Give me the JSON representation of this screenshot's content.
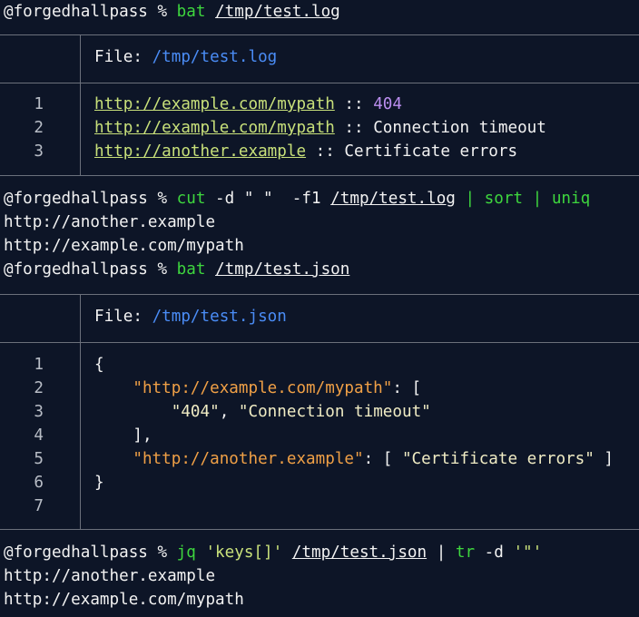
{
  "session": {
    "prompt_user": "@forgedhallpass",
    "prompt_symbol": "%",
    "commands": [
      {
        "cmd": "bat",
        "arg": "/tmp/test.log"
      },
      {
        "cmd": "cut",
        "args": "-d \" \"  -f1",
        "path": "/tmp/test.log",
        "pipe1": "|",
        "cmd2": "sort",
        "pipe2": "|",
        "cmd3": "uniq"
      },
      {
        "cmd": "bat",
        "arg": "/tmp/test.json"
      },
      {
        "cmd": "jq",
        "filter": "'keys[]'",
        "path": "/tmp/test.json",
        "pipe": "|",
        "cmd2": "tr",
        "args2": "-d",
        "quote": "'\"'"
      }
    ]
  },
  "bat_log": {
    "file_label": "File:",
    "file_path": "/tmp/test.log",
    "lines": [
      {
        "num": "1",
        "url": "http://example.com/mypath",
        "sep": " :: ",
        "msg": "404"
      },
      {
        "num": "2",
        "url": "http://example.com/mypath",
        "sep": " :: ",
        "msg": "Connection timeout"
      },
      {
        "num": "3",
        "url": "http://another.example",
        "sep": " :: ",
        "msg": "Certificate errors"
      }
    ]
  },
  "cut_output": [
    "http://another.example",
    "http://example.com/mypath"
  ],
  "bat_json": {
    "file_label": "File:",
    "file_path": "/tmp/test.json",
    "line_numbers": [
      "1",
      "2",
      "3",
      "4",
      "5",
      "6",
      "7"
    ],
    "l1": "{",
    "l2_key": "\"http://example.com/mypath\"",
    "l2_rest": ": [",
    "l3_v1": "\"404\"",
    "l3_comma": ", ",
    "l3_v2": "\"Connection timeout\"",
    "l4": "],",
    "l5_key": "\"http://another.example\"",
    "l5_rest": ": [ ",
    "l5_val": "\"Certificate errors\"",
    "l5_end": " ]",
    "l6": "}"
  },
  "jq_output": [
    "http://another.example",
    "http://example.com/mypath"
  ]
}
